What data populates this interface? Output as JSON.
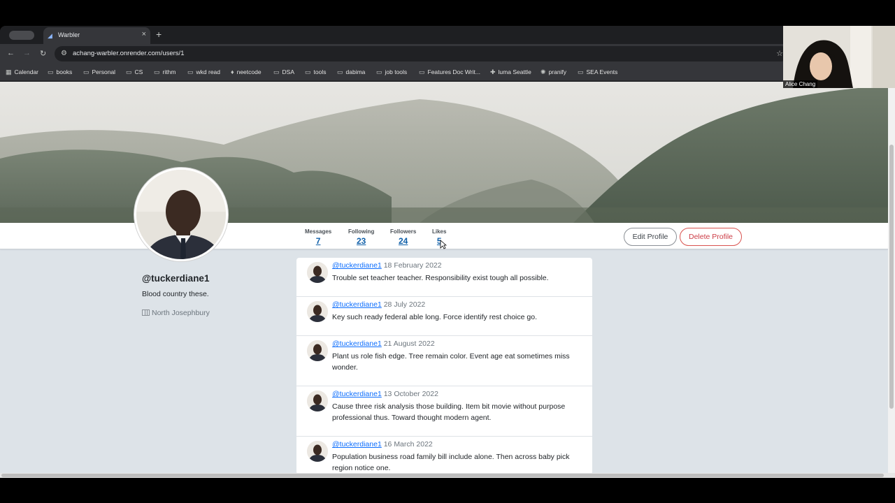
{
  "browser": {
    "tab_group_label": "",
    "tab_title": "Warbler",
    "url": "achang-warbler.onrender.com/users/1",
    "bookmarks": [
      {
        "label": "Calendar",
        "icon": "calendar-icon"
      },
      {
        "label": "books",
        "icon": "folder-icon"
      },
      {
        "label": "Personal",
        "icon": "folder-icon"
      },
      {
        "label": "CS",
        "icon": "folder-icon"
      },
      {
        "label": "rithm",
        "icon": "folder-icon"
      },
      {
        "label": "wkd read",
        "icon": "folder-icon"
      },
      {
        "label": "neetcode",
        "icon": "flame-icon"
      },
      {
        "label": "DSA",
        "icon": "folder-icon"
      },
      {
        "label": "tools",
        "icon": "folder-icon"
      },
      {
        "label": "dabima",
        "icon": "folder-icon"
      },
      {
        "label": "job tools",
        "icon": "folder-icon"
      },
      {
        "label": "Features Doc Writ...",
        "icon": "folder-icon"
      },
      {
        "label": "luma Seattle",
        "icon": "plus-box-icon"
      },
      {
        "label": "pranify",
        "icon": "sun-icon"
      },
      {
        "label": "SEA Events",
        "icon": "folder-icon"
      }
    ]
  },
  "profile": {
    "username": "@tuckerdiane1",
    "bio": "Blood country these.",
    "location": "North Josephbury",
    "stats": [
      {
        "label": "Messages",
        "value": "7"
      },
      {
        "label": "Following",
        "value": "23"
      },
      {
        "label": "Followers",
        "value": "24"
      },
      {
        "label": "Likes",
        "value": "5"
      }
    ],
    "edit_label": "Edit Profile",
    "delete_label": "Delete Profile"
  },
  "messages": [
    {
      "user": "@tuckerdiane1",
      "date": "18 February 2022",
      "text": "Trouble set teacher teacher. Responsibility exist tough all possible."
    },
    {
      "user": "@tuckerdiane1",
      "date": "28 July 2022",
      "text": "Key such ready federal able long. Force identify rest choice go."
    },
    {
      "user": "@tuckerdiane1",
      "date": "21 August 2022",
      "text": "Plant us role fish edge. Tree remain color. Event age eat sometimes miss wonder."
    },
    {
      "user": "@tuckerdiane1",
      "date": "13 October 2022",
      "text": "Cause three risk analysis those building. Item bit movie without purpose professional thus. Toward thought modern agent."
    },
    {
      "user": "@tuckerdiane1",
      "date": "16 March 2022",
      "text": "Population business road family bill include alone. Then across baby pick region notice one."
    }
  ],
  "webcam": {
    "name": "Alice Chang"
  },
  "colors": {
    "link": "#0d6efd",
    "stat": "#0d5ea8",
    "danger": "#cc3b45"
  }
}
